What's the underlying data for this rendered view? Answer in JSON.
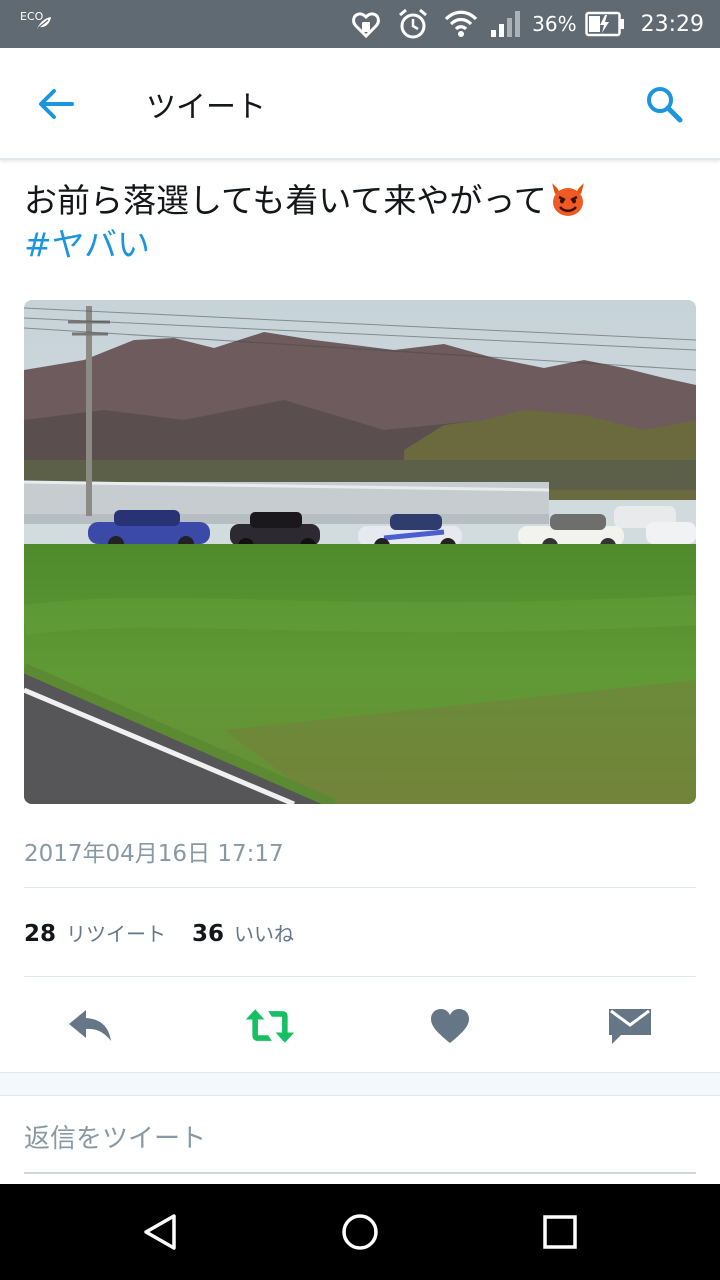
{
  "status_bar": {
    "eco_label": "ECO",
    "battery_percent": "36%",
    "time": "23:29",
    "icons": [
      "eco-leaf-icon",
      "heart-shield-icon",
      "alarm-icon",
      "wifi-icon",
      "signal-icon",
      "battery-charging-icon"
    ]
  },
  "header": {
    "title": "ツイート",
    "back_icon": "back-arrow-icon",
    "search_icon": "search-icon",
    "accent_color": "#1b95e0"
  },
  "tweet": {
    "text": "お前ら落選しても着いて来やがって",
    "emoji": "devil-face-emoji",
    "hashtag": "#ヤバい",
    "photo_description_icon": "tweet-photo",
    "timestamp": "2017年04月16日 17:17",
    "retweet_count": "28",
    "retweet_label": "リツイート",
    "like_count": "36",
    "like_label": "いいね"
  },
  "actions": {
    "reply_icon": "reply-icon",
    "retweet_icon": "retweet-icon",
    "retweet_color": "#17bf63",
    "like_icon": "heart-icon",
    "dm_icon": "direct-message-icon",
    "icon_color": "#657786"
  },
  "reply": {
    "placeholder": "返信をツイート"
  },
  "nav": {
    "icons": [
      "back-triangle-icon",
      "home-circle-icon",
      "recents-square-icon"
    ]
  }
}
